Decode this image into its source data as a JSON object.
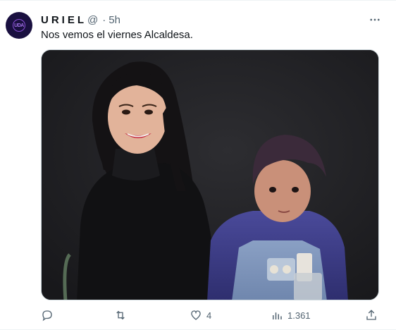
{
  "tweet": {
    "author_name": "URIEL",
    "handle": "@",
    "separator": "·",
    "time": "5h",
    "text": "Nos vemos el viernes Alcaldesa.",
    "avatar_icon": "logo-avatar",
    "media_description_icon": "photo-media",
    "actions": {
      "reply_count": "",
      "retweet_count": "",
      "like_count": "4",
      "views_count": "1.361"
    }
  },
  "colors": {
    "text": "#0f1419",
    "secondary": "#536471",
    "avatar_bg": "#1a1040",
    "accent": "#8a4fd6"
  }
}
